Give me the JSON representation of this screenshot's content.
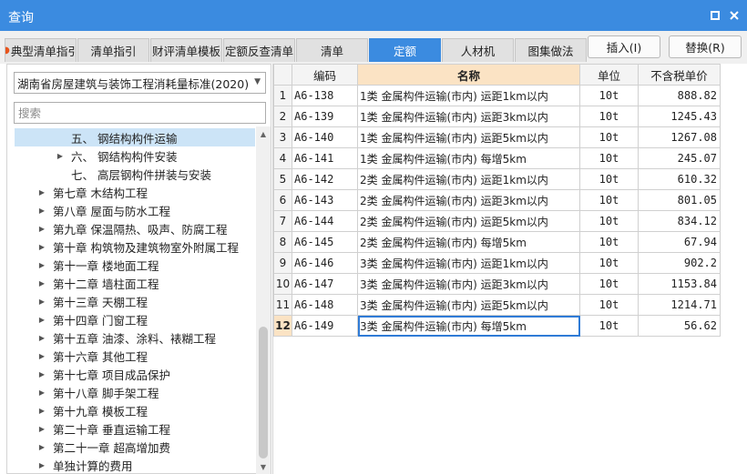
{
  "window": {
    "title": "查询"
  },
  "tabs": [
    {
      "label": "典型清单指引",
      "active": false,
      "flame": true
    },
    {
      "label": "清单指引",
      "active": false
    },
    {
      "label": "财评清单模板",
      "active": false
    },
    {
      "label": "定额反查清单",
      "active": false
    },
    {
      "label": "清单",
      "active": false
    },
    {
      "label": "定额",
      "active": true
    },
    {
      "label": "人材机",
      "active": false
    },
    {
      "label": "图集做法",
      "active": false
    }
  ],
  "actions": {
    "insert": "插入(I)",
    "replace": "替换(R)"
  },
  "left": {
    "standard": "湖南省房屋建筑与装饰工程消耗量标准(2020)",
    "search_placeholder": "搜索",
    "tree": [
      {
        "label": "五、 钢结构构件运输",
        "indent": 2,
        "expander": "",
        "selected": true
      },
      {
        "label": "六、 钢结构构件安装",
        "indent": 2,
        "expander": "▶",
        "selected": false
      },
      {
        "label": "七、 高层钢构件拼装与安装",
        "indent": 2,
        "expander": "",
        "selected": false
      },
      {
        "label": "第七章 木结构工程",
        "indent": 1,
        "expander": "▶",
        "selected": false
      },
      {
        "label": "第八章 屋面与防水工程",
        "indent": 1,
        "expander": "▶",
        "selected": false
      },
      {
        "label": "第九章 保温隔热、吸声、防腐工程",
        "indent": 1,
        "expander": "▶",
        "selected": false
      },
      {
        "label": "第十章 构筑物及建筑物室外附属工程",
        "indent": 1,
        "expander": "▶",
        "selected": false
      },
      {
        "label": "第十一章 楼地面工程",
        "indent": 1,
        "expander": "▶",
        "selected": false
      },
      {
        "label": "第十二章 墙柱面工程",
        "indent": 1,
        "expander": "▶",
        "selected": false
      },
      {
        "label": "第十三章 天棚工程",
        "indent": 1,
        "expander": "▶",
        "selected": false
      },
      {
        "label": "第十四章 门窗工程",
        "indent": 1,
        "expander": "▶",
        "selected": false
      },
      {
        "label": "第十五章 油漆、涂料、裱糊工程",
        "indent": 1,
        "expander": "▶",
        "selected": false
      },
      {
        "label": "第十六章 其他工程",
        "indent": 1,
        "expander": "▶",
        "selected": false
      },
      {
        "label": "第十七章 项目成品保护",
        "indent": 1,
        "expander": "▶",
        "selected": false
      },
      {
        "label": "第十八章 脚手架工程",
        "indent": 1,
        "expander": "▶",
        "selected": false
      },
      {
        "label": "第十九章 模板工程",
        "indent": 1,
        "expander": "▶",
        "selected": false
      },
      {
        "label": "第二十章 垂直运输工程",
        "indent": 1,
        "expander": "▶",
        "selected": false
      },
      {
        "label": "第二十一章 超高增加费",
        "indent": 1,
        "expander": "▶",
        "selected": false
      },
      {
        "label": "单独计算的费用",
        "indent": 1,
        "expander": "▶",
        "selected": false
      }
    ]
  },
  "grid": {
    "columns": [
      "编码",
      "名称",
      "单位",
      "不含税单价"
    ],
    "selected_column": 1,
    "current_row": 11,
    "rows": [
      {
        "n": "1",
        "code": "A6-138",
        "name": "1类 金属构件运输(市内) 运距1km以内",
        "unit": "10t",
        "price": "888.82"
      },
      {
        "n": "2",
        "code": "A6-139",
        "name": "1类 金属构件运输(市内) 运距3km以内",
        "unit": "10t",
        "price": "1245.43"
      },
      {
        "n": "3",
        "code": "A6-140",
        "name": "1类 金属构件运输(市内) 运距5km以内",
        "unit": "10t",
        "price": "1267.08"
      },
      {
        "n": "4",
        "code": "A6-141",
        "name": "1类 金属构件运输(市内) 每增5km",
        "unit": "10t",
        "price": "245.07"
      },
      {
        "n": "5",
        "code": "A6-142",
        "name": "2类 金属构件运输(市内) 运距1km以内",
        "unit": "10t",
        "price": "610.32"
      },
      {
        "n": "6",
        "code": "A6-143",
        "name": "2类 金属构件运输(市内) 运距3km以内",
        "unit": "10t",
        "price": "801.05"
      },
      {
        "n": "7",
        "code": "A6-144",
        "name": "2类 金属构件运输(市内) 运距5km以内",
        "unit": "10t",
        "price": "834.12"
      },
      {
        "n": "8",
        "code": "A6-145",
        "name": "2类 金属构件运输(市内) 每增5km",
        "unit": "10t",
        "price": "67.94"
      },
      {
        "n": "9",
        "code": "A6-146",
        "name": "3类 金属构件运输(市内) 运距1km以内",
        "unit": "10t",
        "price": "902.2"
      },
      {
        "n": "10",
        "code": "A6-147",
        "name": "3类 金属构件运输(市内) 运距3km以内",
        "unit": "10t",
        "price": "1153.84"
      },
      {
        "n": "11",
        "code": "A6-148",
        "name": "3类 金属构件运输(市内) 运距5km以内",
        "unit": "10t",
        "price": "1214.71"
      },
      {
        "n": "12",
        "code": "A6-149",
        "name": "3类 金属构件运输(市内) 每增5km",
        "unit": "10t",
        "price": "56.62"
      }
    ]
  },
  "colors": {
    "accent": "#3b8be0",
    "selection": "#cce4f7",
    "current": "#fbe3c4"
  }
}
